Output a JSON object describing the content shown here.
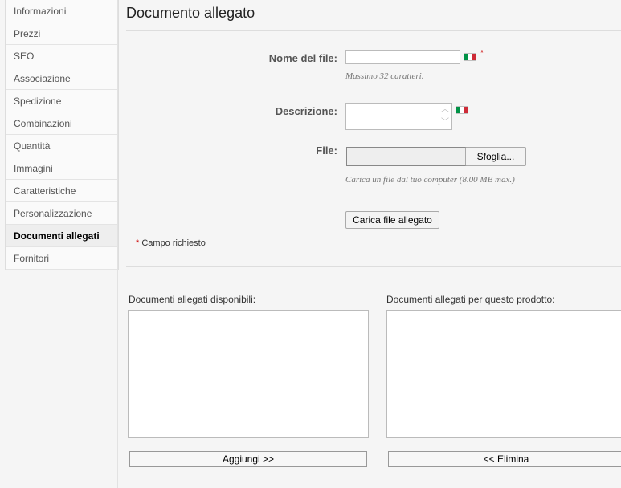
{
  "sidebar": {
    "items": [
      {
        "label": "Informazioni"
      },
      {
        "label": "Prezzi"
      },
      {
        "label": "SEO"
      },
      {
        "label": "Associazione"
      },
      {
        "label": "Spedizione"
      },
      {
        "label": "Combinazioni"
      },
      {
        "label": "Quantità"
      },
      {
        "label": "Immagini"
      },
      {
        "label": "Caratteristiche"
      },
      {
        "label": "Personalizzazione"
      },
      {
        "label": "Documenti allegati",
        "active": true
      },
      {
        "label": "Fornitori"
      }
    ]
  },
  "main": {
    "title": "Documento allegato",
    "form": {
      "filename_label": "Nome del file:",
      "filename_value": "",
      "filename_hint": "Massimo 32 caratteri.",
      "description_label": "Descrizione:",
      "description_value": "",
      "file_label": "File:",
      "browse_label": "Sfoglia...",
      "file_hint": "Carica un file dal tuo computer (8.00 MB max.)",
      "upload_label": "Carica file allegato",
      "required_star": "*",
      "required_note": "Campo richiesto"
    },
    "lists": {
      "available_label": "Documenti allegati disponibili:",
      "product_label": "Documenti allegati per questo prodotto:",
      "available_items": [],
      "product_items": [],
      "add_label": "Aggiungi >>",
      "remove_label": "<< Elimina"
    }
  },
  "colors": {
    "flag_green": "#009246",
    "flag_white": "#ffffff",
    "flag_red": "#ce2b37",
    "required_red": "#cc0000"
  },
  "icons": [
    "italian-flag-icon",
    "scroll-up-icon",
    "scroll-down-icon"
  ]
}
